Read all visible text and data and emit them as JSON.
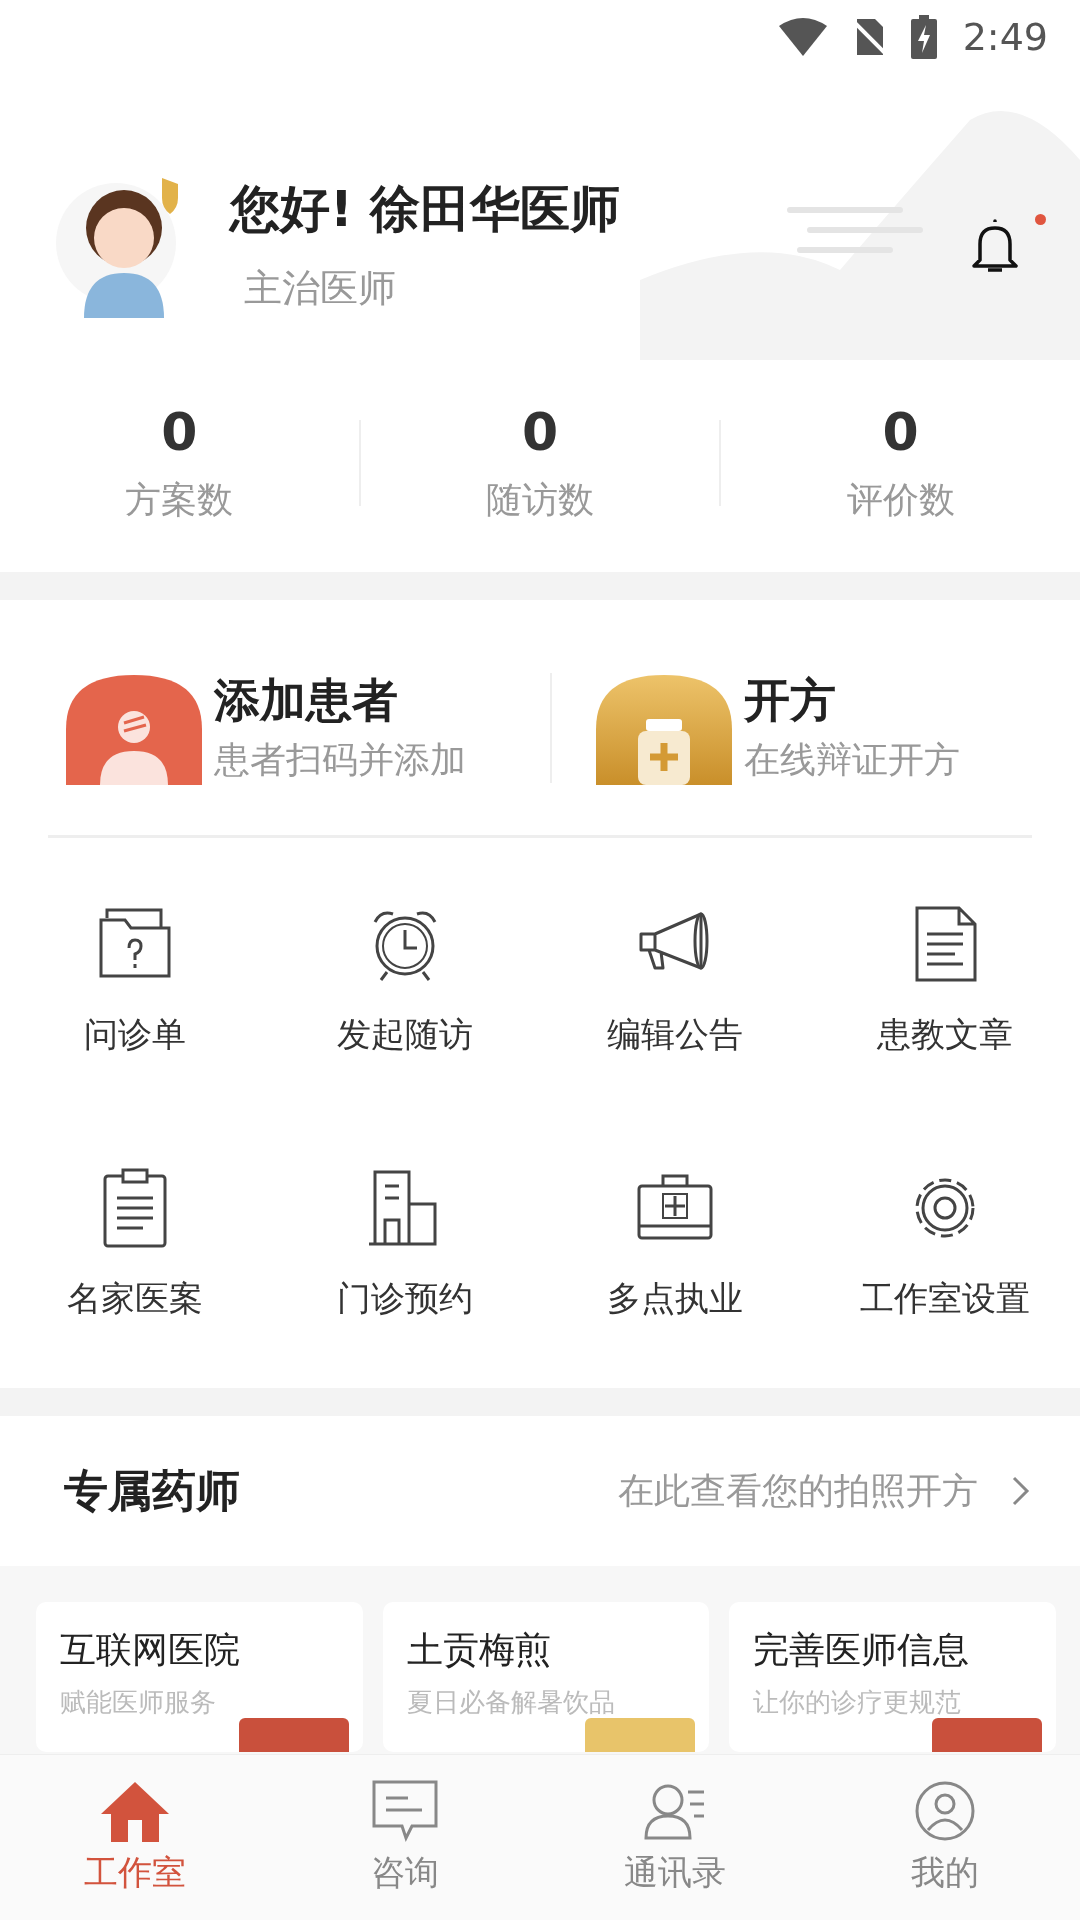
{
  "status_bar": {
    "time": "2:49"
  },
  "profile": {
    "greeting": "您好! 徐田华医师",
    "title": "主治医师",
    "notification_unread": true
  },
  "stats": [
    {
      "value": "0",
      "label": "方案数"
    },
    {
      "value": "0",
      "label": "随访数"
    },
    {
      "value": "0",
      "label": "评价数"
    }
  ],
  "actions": [
    {
      "kind": "patient",
      "title": "添加患者",
      "subtitle": "患者扫码并添加"
    },
    {
      "kind": "prescribe",
      "title": "开方",
      "subtitle": "在线辩证开方"
    }
  ],
  "tools": [
    {
      "kind": "folder",
      "label": "问诊单"
    },
    {
      "kind": "clock",
      "label": "发起随访"
    },
    {
      "kind": "megaphone",
      "label": "编辑公告"
    },
    {
      "kind": "document",
      "label": "患教文章"
    },
    {
      "kind": "clipboard",
      "label": "名家医案"
    },
    {
      "kind": "building",
      "label": "门诊预约"
    },
    {
      "kind": "kit",
      "label": "多点执业"
    },
    {
      "kind": "gear",
      "label": "工作室设置"
    }
  ],
  "pharmacist": {
    "title": "专属药师",
    "link": "在此查看您的拍照开方"
  },
  "banners": [
    {
      "title": "互联网医院",
      "subtitle": "赋能医师服务",
      "color": "#c9503c"
    },
    {
      "title": "土贡梅煎",
      "subtitle": "夏日必备解暑饮品",
      "color": "#e8c46a"
    },
    {
      "title": "完善医师信息",
      "subtitle": "让你的诊疗更规范",
      "color": "#c9503c"
    }
  ],
  "tab_bar": [
    {
      "kind": "home",
      "label": "工作室",
      "selected": true
    },
    {
      "kind": "chat",
      "label": "咨询",
      "selected": false
    },
    {
      "kind": "contacts",
      "label": "通讯录",
      "selected": false
    },
    {
      "kind": "person",
      "label": "我的",
      "selected": false
    }
  ]
}
